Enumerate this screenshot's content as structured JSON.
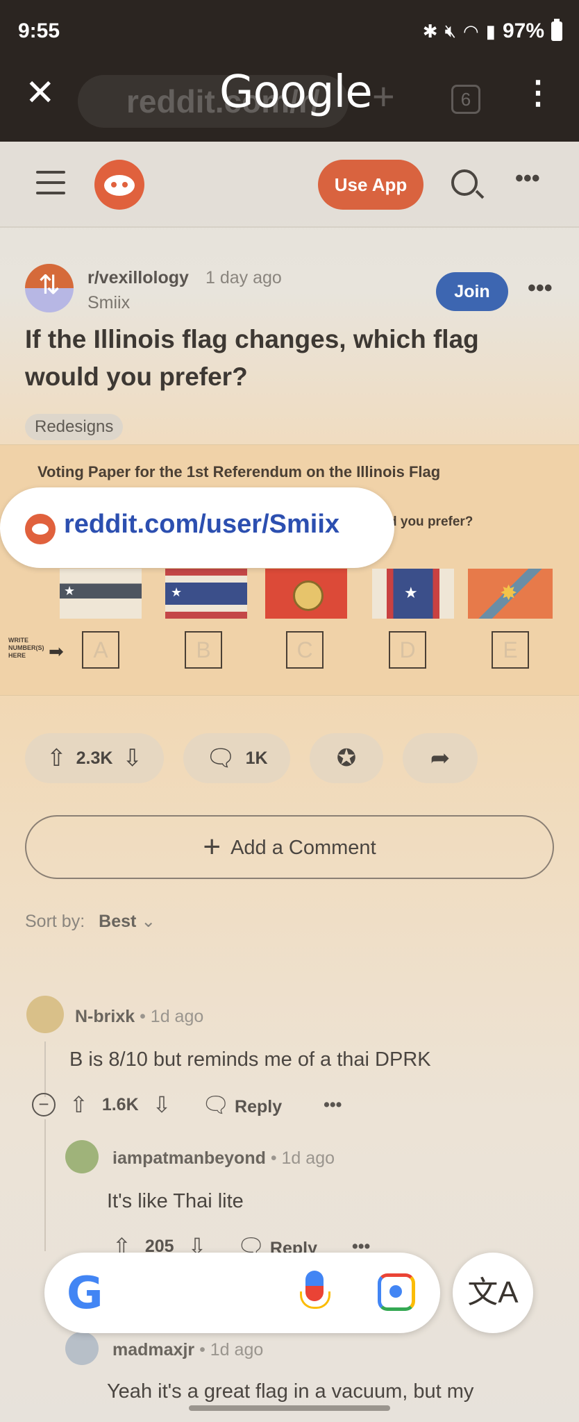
{
  "status": {
    "time": "9:55",
    "battery": "97%",
    "icons": [
      "bluetooth-icon",
      "mute-icon",
      "wifi-icon",
      "signal-icon"
    ]
  },
  "google_overlay": {
    "logo": "Google",
    "ghost_url": "reddit.com/r/",
    "tab_count": "6"
  },
  "reddit_header": {
    "use_app": "Use App"
  },
  "post": {
    "subreddit": "r/vexillology",
    "time_ago": "1 day ago",
    "author": "Smiix",
    "join": "Join",
    "title": "If the Illinois flag changes, which flag would you prefer?",
    "flair": "Redesigns",
    "image": {
      "heading": "Voting Paper for the 1st Referendum on the Illinois Flag",
      "question_fragment": "d you prefer?",
      "write_label": "WRITE NUMBER(S) HERE",
      "boxes": [
        "A",
        "B",
        "C",
        "D",
        "E"
      ]
    },
    "votes": "2.3K",
    "comments": "1K",
    "add_comment": "Add a Comment",
    "sort_label": "Sort by:",
    "sort_value": "Best"
  },
  "url_chip": {
    "text": "reddit.com/user/Smiix"
  },
  "comments": [
    {
      "user": "N-brixk",
      "time": "1d ago",
      "body": "B is 8/10 but reminds me of a thai DPRK",
      "votes": "1.6K",
      "reply": "Reply"
    },
    {
      "user": "iampatmanbeyond",
      "time": "1d ago",
      "body": "It's like Thai lite",
      "votes": "205",
      "reply": "Reply"
    },
    {
      "user": "madmaxjr",
      "time": "1d ago",
      "body": "Yeah it's a great flag in a vacuum, but my"
    }
  ]
}
